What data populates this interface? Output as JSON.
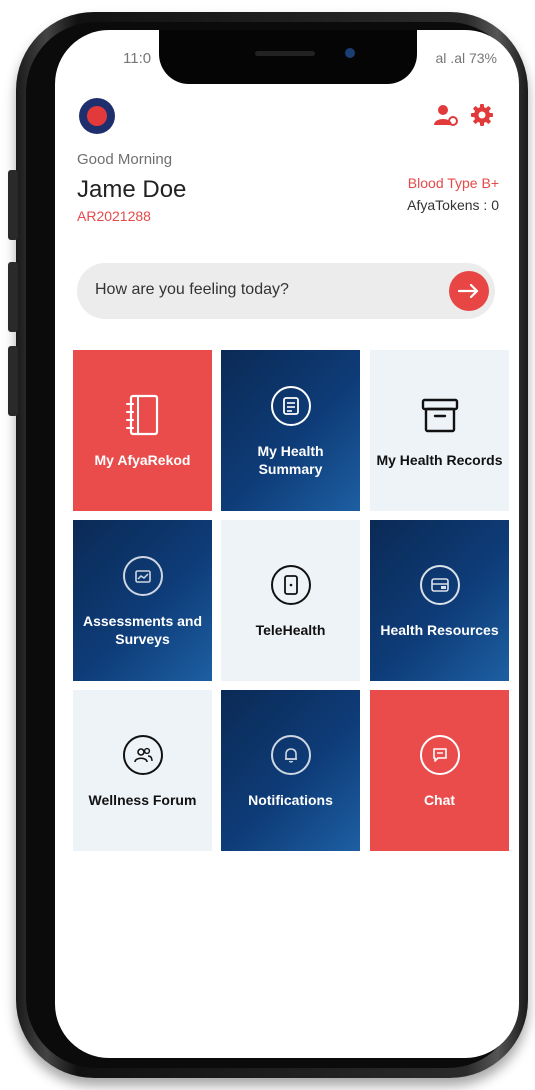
{
  "status_bar": {
    "time": "11:0",
    "signal_battery": "al .al 73%"
  },
  "header": {
    "greeting": "Good Morning",
    "user_name": "Jame Doe",
    "patient_id": "AR2021288",
    "blood_type": "Blood Type B+",
    "tokens": "AfyaTokens : 0"
  },
  "feeling": {
    "prompt": "How are you feeling today?"
  },
  "tiles": [
    {
      "label": "My AfyaRekod",
      "icon": "notebook-icon",
      "color": "#ea4b4b"
    },
    {
      "label": "My Health Summary",
      "icon": "document-icon",
      "color": "#0e3c78"
    },
    {
      "label": "My Health Records",
      "icon": "archive-box-icon",
      "color": "#eef3f8"
    },
    {
      "label": "Assessments and Surveys",
      "icon": "chart-icon",
      "color": "#0e3c78"
    },
    {
      "label": "TeleHealth",
      "icon": "phone-device-icon",
      "color": "#eef3f8"
    },
    {
      "label": "Health Resources",
      "icon": "folder-icon",
      "color": "#0e3c78"
    },
    {
      "label": "Wellness Forum",
      "icon": "users-icon",
      "color": "#eef3f8"
    },
    {
      "label": "Notifications",
      "icon": "bell-icon",
      "color": "#0e3c78"
    },
    {
      "label": "Chat",
      "icon": "chat-icon",
      "color": "#ea4b4b"
    }
  ],
  "colors": {
    "accent_red": "#e84545",
    "navy": "#0e3c78",
    "light_tile": "#eef3f8"
  }
}
